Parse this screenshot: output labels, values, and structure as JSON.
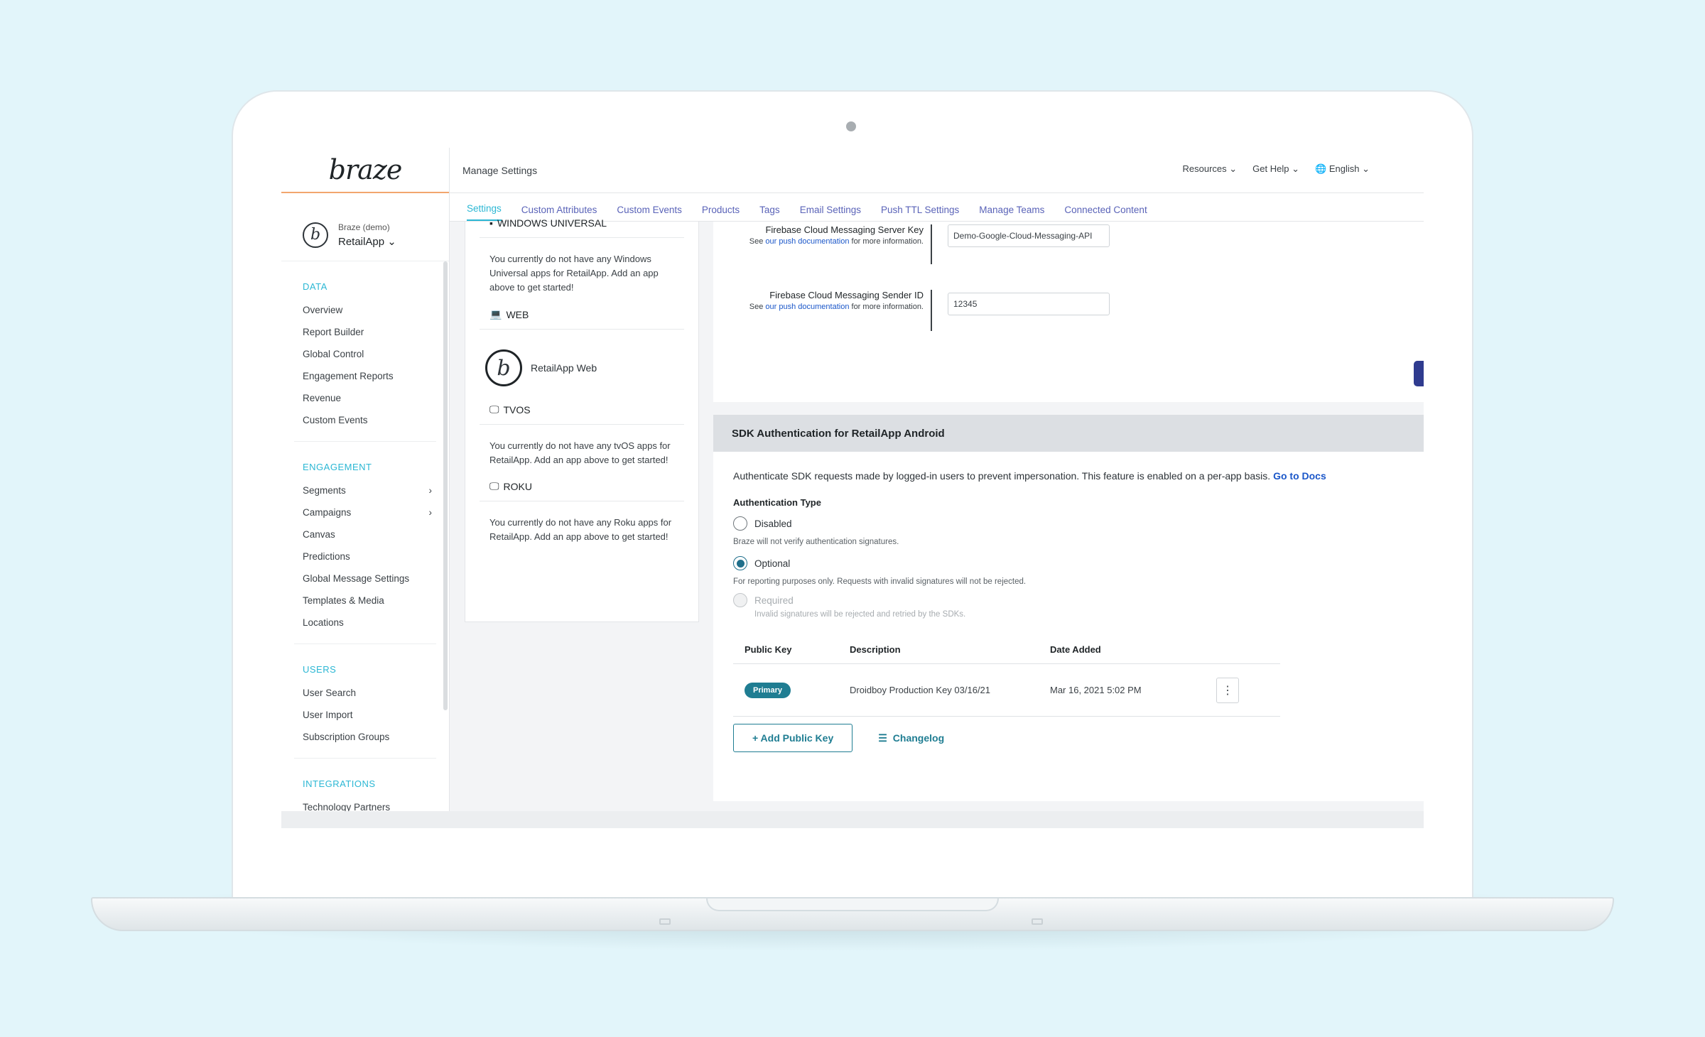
{
  "app": {
    "logo": "braze",
    "org": "Braze (demo)",
    "name": "RetailApp"
  },
  "header": {
    "title": "Manage Settings",
    "resources": "Resources",
    "get_help": "Get Help",
    "language": "English"
  },
  "tabs": [
    {
      "label": "Settings",
      "active": true
    },
    {
      "label": "Custom Attributes"
    },
    {
      "label": "Custom Events"
    },
    {
      "label": "Products"
    },
    {
      "label": "Tags"
    },
    {
      "label": "Email Settings"
    },
    {
      "label": "Push TTL Settings"
    },
    {
      "label": "Manage Teams"
    },
    {
      "label": "Connected Content"
    }
  ],
  "sidebar": {
    "sections": [
      {
        "heading": "DATA",
        "items": [
          "Overview",
          "Report Builder",
          "Global Control",
          "Engagement Reports",
          "Revenue",
          "Custom Events"
        ]
      },
      {
        "heading": "ENGAGEMENT",
        "items": [
          "Segments",
          "Campaigns",
          "Canvas",
          "Predictions",
          "Global Message Settings",
          "Templates & Media",
          "Locations"
        ]
      },
      {
        "heading": "USERS",
        "items": [
          "User Search",
          "User Import",
          "Subscription Groups"
        ]
      },
      {
        "heading": "INTEGRATIONS",
        "items": [
          "Technology Partners"
        ]
      }
    ]
  },
  "platforms": {
    "windows": {
      "title": "WINDOWS UNIVERSAL",
      "note": "You currently do not have any Windows Universal apps for RetailApp. Add an app above to get started!"
    },
    "web": {
      "title": "WEB",
      "app": "RetailApp Web"
    },
    "tvos": {
      "title": "TVOS",
      "note": "You currently do not have any tvOS apps for RetailApp. Add an app above to get started!"
    },
    "roku": {
      "title": "ROKU",
      "note": "You currently do not have any Roku apps for RetailApp. Add an app above to get started!"
    }
  },
  "firebase": {
    "server_key_label": "Firebase Cloud Messaging Server Key",
    "server_key_value": "Demo-Google-Cloud-Messaging-API",
    "sender_id_label": "Firebase Cloud Messaging Sender ID",
    "sender_id_value": "12345",
    "hint_prefix": "See ",
    "hint_link": "our push documentation",
    "hint_suffix": " for more information."
  },
  "sdk": {
    "title": "SDK Authentication for RetailApp Android",
    "description": "Authenticate SDK requests made by logged-in users to prevent impersonation. This feature is enabled on a per-app basis.",
    "docs_link": "Go to Docs",
    "auth_type_label": "Authentication Type",
    "options": [
      {
        "label": "Disabled",
        "hint": "Braze will not verify authentication signatures.",
        "state": "off"
      },
      {
        "label": "Optional",
        "hint": "For reporting purposes only. Requests with invalid signatures will not be rejected.",
        "state": "on"
      },
      {
        "label": "Required",
        "hint": "Invalid signatures will be rejected and retried by the SDKs.",
        "state": "disabled"
      }
    ],
    "table": {
      "headers": [
        "Public Key",
        "Description",
        "Date Added"
      ],
      "rows": [
        {
          "badge": "Primary",
          "description": "Droidboy Production Key 03/16/21",
          "date": "Mar 16, 2021 5:02 PM"
        }
      ]
    },
    "add_key_label": "+ Add Public Key",
    "changelog_label": "Changelog"
  }
}
